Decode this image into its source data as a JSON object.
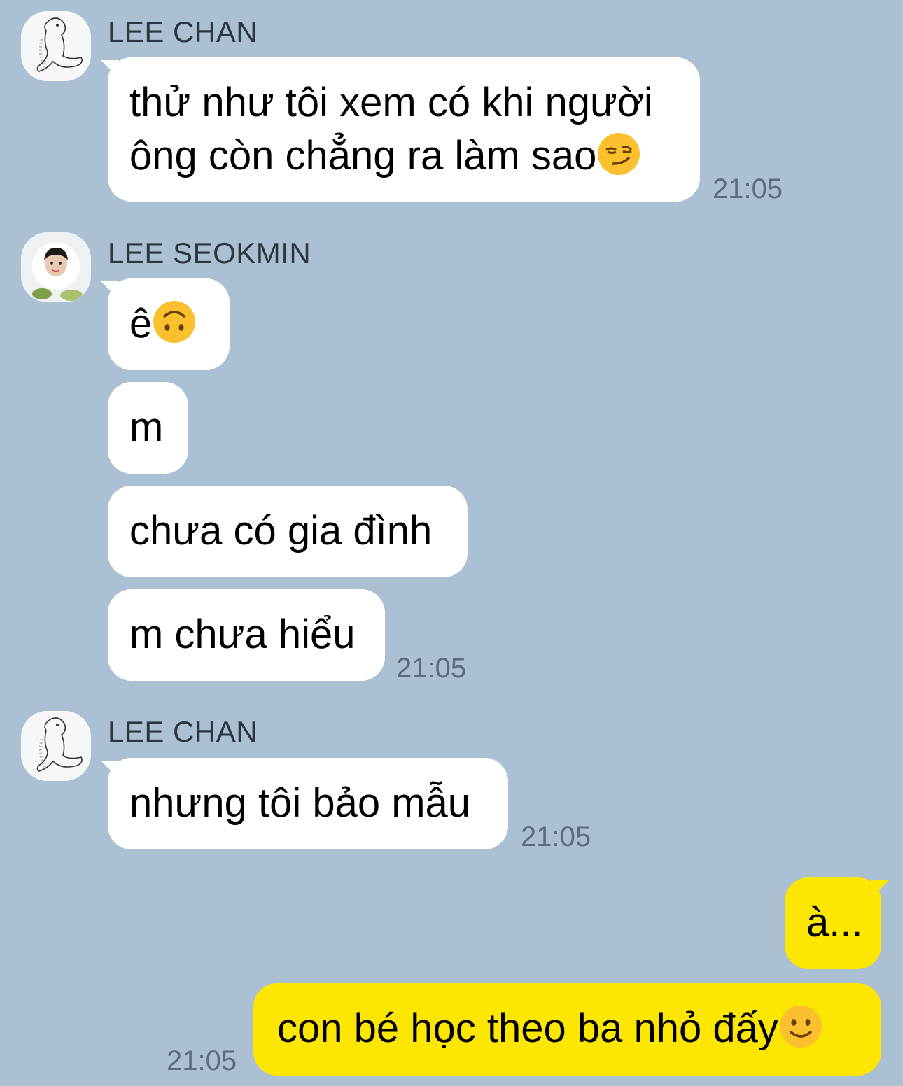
{
  "messages": [
    {
      "sender": "LEE CHAN",
      "avatar": "line-drawing-avatar",
      "lines": [
        "thử như tôi xem có khi người",
        "ông còn chẳng ra làm sao"
      ],
      "emoji": "smirking-face-emoji",
      "time": "21:05"
    },
    {
      "sender": "LEE SEOKMIN",
      "avatar": "photo-avatar",
      "bubbles": [
        {
          "text": "ê",
          "emoji": "upside-down-face-emoji"
        },
        {
          "text": "m"
        },
        {
          "text": "chưa có gia đình"
        },
        {
          "text": "m chưa hiểu"
        }
      ],
      "time": "21:05"
    },
    {
      "sender": "LEE CHAN",
      "avatar": "line-drawing-avatar",
      "text": "nhưng tôi bảo mẫu",
      "time": "21:05"
    },
    {
      "sender": "me",
      "bubbles": [
        {
          "text": "à..."
        },
        {
          "text": "con bé học theo ba nhỏ đấy",
          "emoji": "slightly-smiling-face-emoji"
        }
      ],
      "time": "21:05"
    }
  ],
  "colors": {
    "background": "#abc1d3",
    "incoming_bubble": "#ffffff",
    "outgoing_bubble": "#fde600",
    "timestamp": "#5b6b7a"
  }
}
